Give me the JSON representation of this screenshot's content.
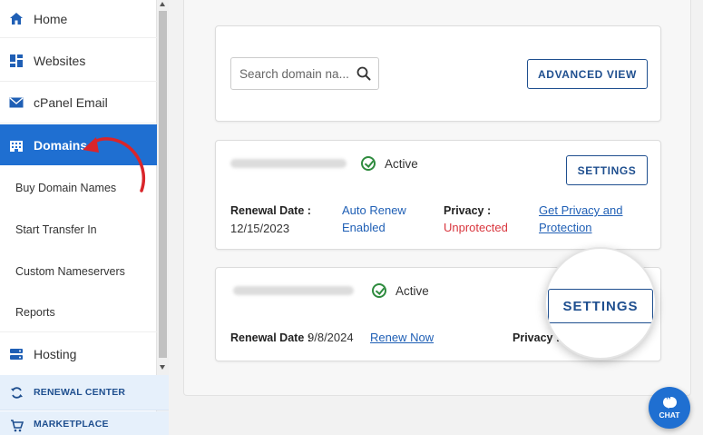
{
  "sidebar": {
    "items": [
      {
        "label": "Home",
        "icon": "home-icon"
      },
      {
        "label": "Websites",
        "icon": "websites-icon"
      },
      {
        "label": "cPanel Email",
        "icon": "envelope-icon"
      },
      {
        "label": "Domains",
        "icon": "domains-icon"
      }
    ],
    "sub_items": [
      "Buy Domain Names",
      "Start Transfer In",
      "Custom Nameservers",
      "Reports"
    ],
    "hosting": {
      "label": "Hosting",
      "icon": "hosting-icon"
    },
    "footer": [
      {
        "label": "RENEWAL CENTER",
        "icon": "refresh-icon"
      },
      {
        "label": "MARKETPLACE",
        "icon": "cart-icon"
      }
    ]
  },
  "search": {
    "placeholder": "Search domain na..."
  },
  "advanced_view_label": "ADVANCED VIEW",
  "domains": [
    {
      "status": "Active",
      "settings_label": "SETTINGS",
      "renewal_label": "Renewal Date :",
      "renewal_date": "12/15/2023",
      "auto_renew_line1": "Auto Renew",
      "auto_renew_line2": "Enabled",
      "privacy_label": "Privacy :",
      "privacy_value": "Unprotected",
      "privacy_link_line1": "Get Privacy and",
      "privacy_link_line2": "Protection"
    },
    {
      "status": "Active",
      "settings_label": "SETTINGS",
      "renewal_label": "Renewal Date :",
      "renewal_date": "9/8/2024",
      "renew_now_label": "Renew Now",
      "privacy_label": "Privacy :"
    }
  ],
  "chat_label": "CHAT",
  "colors": {
    "primary": "#1f6fd1",
    "annotation_arrow": "#d9252a",
    "active_check": "#2e8b3e",
    "unprotected": "#d9363e"
  }
}
